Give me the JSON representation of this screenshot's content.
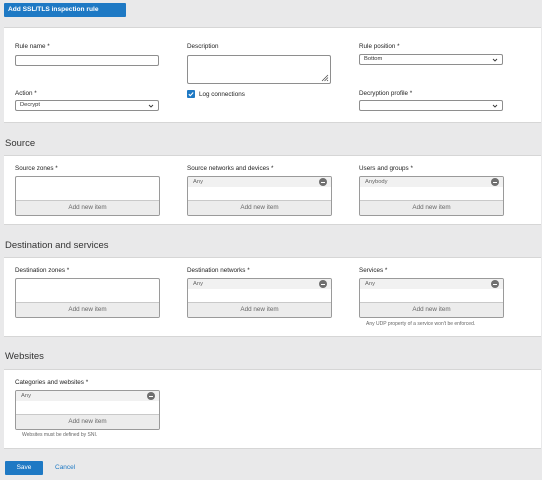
{
  "header": {
    "title_button": "Add SSL/TLS inspection rule"
  },
  "rule": {
    "name_label": "Rule name *",
    "name_value": "",
    "description_label": "Description",
    "description_value": "",
    "position_label": "Rule position *",
    "position_value": "Bottom",
    "action_label": "Action *",
    "action_value": "Decrypt",
    "log_label": "Log connections",
    "log_checked": true,
    "profile_label": "Decryption profile *",
    "profile_value": ""
  },
  "source": {
    "title": "Source",
    "zones": {
      "label": "Source zones *",
      "items": [],
      "add": "Add new item"
    },
    "networks": {
      "label": "Source networks and devices *",
      "items": [
        "Any"
      ],
      "add": "Add new item"
    },
    "users": {
      "label": "Users and groups *",
      "items": [
        "Anybody"
      ],
      "add": "Add new item"
    }
  },
  "destination": {
    "title": "Destination and services",
    "zones": {
      "label": "Destination zones *",
      "items": [],
      "add": "Add new item"
    },
    "networks": {
      "label": "Destination networks *",
      "items": [
        "Any"
      ],
      "add": "Add new item"
    },
    "services": {
      "label": "Services *",
      "items": [
        "Any"
      ],
      "add": "Add new item",
      "note": "Any UDP property of a service won't be enforced."
    }
  },
  "websites": {
    "title": "Websites",
    "categories": {
      "label": "Categories and websites *",
      "items": [
        "Any"
      ],
      "add": "Add new item",
      "note": "Websites must be defined by SNI."
    }
  },
  "footer": {
    "save": "Save",
    "cancel": "Cancel"
  },
  "colors": {
    "accent": "#1e79c4",
    "background": "#e9e9ea",
    "panel": "#ffffff"
  },
  "icons": {
    "dropdown": "chevron-down-icon",
    "remove": "minus-circle-icon",
    "checkbox": "checkbox-checked-icon",
    "resize": "resize-grip-icon"
  }
}
